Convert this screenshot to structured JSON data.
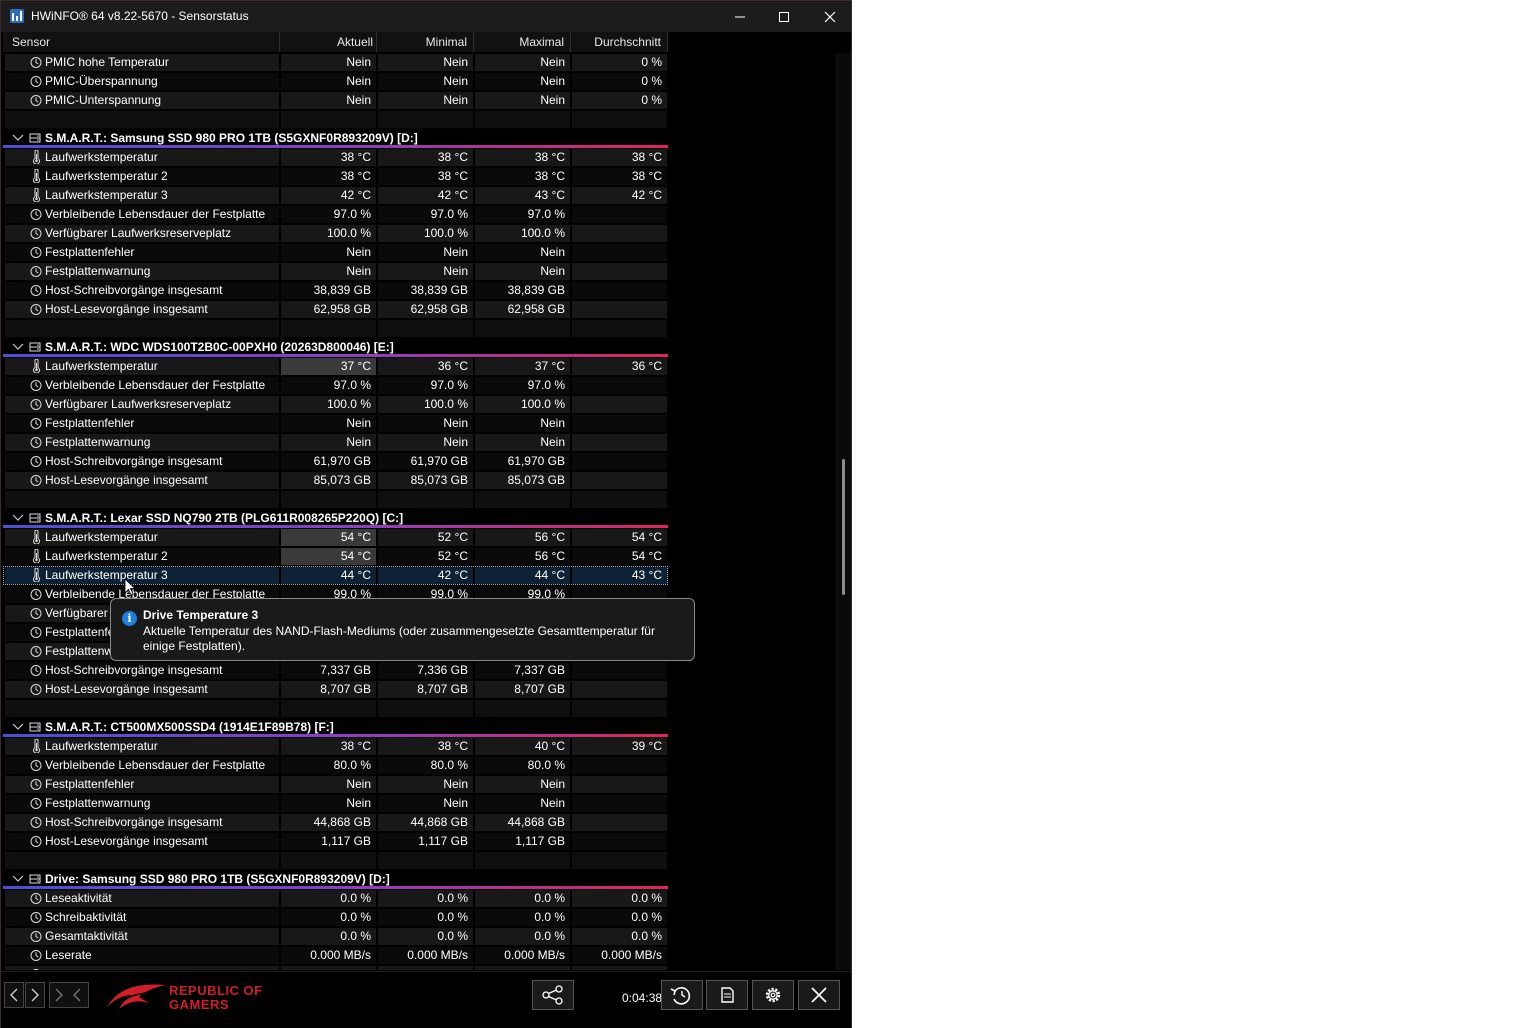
{
  "window": {
    "title": "HWiNFO® 64 v8.22-5670 - Sensorstatus",
    "controls": {
      "minimize": "—",
      "maximize": "☐",
      "close": "✕"
    }
  },
  "columns": [
    "Sensor",
    "Aktuell",
    "Minimal",
    "Maximal",
    "Durchschnitt"
  ],
  "rows": [
    {
      "type": "row",
      "icon": "clock",
      "cells": [
        "PMIC hohe Temperatur",
        "Nein",
        "Nein",
        "Nein",
        "0 %"
      ]
    },
    {
      "type": "row",
      "icon": "clock",
      "cells": [
        "PMIC-Überspannung",
        "Nein",
        "Nein",
        "Nein",
        "0 %"
      ]
    },
    {
      "type": "row",
      "icon": "clock",
      "cells": [
        "PMIC-Unterspannung",
        "Nein",
        "Nein",
        "Nein",
        "0 %"
      ]
    },
    {
      "type": "blank"
    },
    {
      "type": "group",
      "label": "S.M.A.R.T.: Samsung SSD 980 PRO 1TB (S5GXNF0R893209V) [D:]"
    },
    {
      "type": "row",
      "icon": "thermo",
      "cells": [
        "Laufwerkstemperatur",
        "38 °C",
        "38 °C",
        "38 °C",
        "38 °C"
      ]
    },
    {
      "type": "row",
      "icon": "thermo",
      "cells": [
        "Laufwerkstemperatur 2",
        "38 °C",
        "38 °C",
        "38 °C",
        "38 °C"
      ]
    },
    {
      "type": "row",
      "icon": "thermo",
      "cells": [
        "Laufwerkstemperatur 3",
        "42 °C",
        "42 °C",
        "43 °C",
        "42 °C"
      ]
    },
    {
      "type": "row",
      "icon": "clock",
      "cells": [
        "Verbleibende Lebensdauer der Festplatte",
        "97.0 %",
        "97.0 %",
        "97.0 %",
        ""
      ]
    },
    {
      "type": "row",
      "icon": "clock",
      "cells": [
        "Verfügbarer Laufwerksreserveplatz",
        "100.0 %",
        "100.0 %",
        "100.0 %",
        ""
      ]
    },
    {
      "type": "row",
      "icon": "clock",
      "cells": [
        "Festplattenfehler",
        "Nein",
        "Nein",
        "Nein",
        ""
      ]
    },
    {
      "type": "row",
      "icon": "clock",
      "cells": [
        "Festplattenwarnung",
        "Nein",
        "Nein",
        "Nein",
        ""
      ]
    },
    {
      "type": "row",
      "icon": "clock",
      "cells": [
        "Host-Schreibvorgänge insgesamt",
        "38,839 GB",
        "38,839 GB",
        "38,839 GB",
        ""
      ]
    },
    {
      "type": "row",
      "icon": "clock",
      "cells": [
        "Host-Lesevorgänge insgesamt",
        "62,958 GB",
        "62,958 GB",
        "62,958 GB",
        ""
      ]
    },
    {
      "type": "blank"
    },
    {
      "type": "group",
      "label": "S.M.A.R.T.: WDC WDS100T2B0C-00PXH0 (20263D800046) [E:]"
    },
    {
      "type": "row",
      "icon": "thermo",
      "hl": true,
      "cells": [
        "Laufwerkstemperatur",
        "37 °C",
        "36 °C",
        "37 °C",
        "36 °C"
      ]
    },
    {
      "type": "row",
      "icon": "clock",
      "cells": [
        "Verbleibende Lebensdauer der Festplatte",
        "97.0 %",
        "97.0 %",
        "97.0 %",
        ""
      ]
    },
    {
      "type": "row",
      "icon": "clock",
      "cells": [
        "Verfügbarer Laufwerksreserveplatz",
        "100.0 %",
        "100.0 %",
        "100.0 %",
        ""
      ]
    },
    {
      "type": "row",
      "icon": "clock",
      "cells": [
        "Festplattenfehler",
        "Nein",
        "Nein",
        "Nein",
        ""
      ]
    },
    {
      "type": "row",
      "icon": "clock",
      "cells": [
        "Festplattenwarnung",
        "Nein",
        "Nein",
        "Nein",
        ""
      ]
    },
    {
      "type": "row",
      "icon": "clock",
      "cells": [
        "Host-Schreibvorgänge insgesamt",
        "61,970 GB",
        "61,970 GB",
        "61,970 GB",
        ""
      ]
    },
    {
      "type": "row",
      "icon": "clock",
      "cells": [
        "Host-Lesevorgänge insgesamt",
        "85,073 GB",
        "85,073 GB",
        "85,073 GB",
        ""
      ]
    },
    {
      "type": "blank"
    },
    {
      "type": "group",
      "label": "S.M.A.R.T.: Lexar SSD NQ790 2TB (PLG611R008265P220Q) [C:]"
    },
    {
      "type": "row",
      "icon": "thermo",
      "hl": true,
      "cells": [
        "Laufwerkstemperatur",
        "54 °C",
        "52 °C",
        "56 °C",
        "54 °C"
      ]
    },
    {
      "type": "row",
      "icon": "thermo",
      "hl": true,
      "cells": [
        "Laufwerkstemperatur 2",
        "54 °C",
        "52 °C",
        "56 °C",
        "54 °C"
      ]
    },
    {
      "type": "row",
      "icon": "thermo",
      "sel": true,
      "cells": [
        "Laufwerkstemperatur 3",
        "44 °C",
        "42 °C",
        "44 °C",
        "43 °C"
      ]
    },
    {
      "type": "row",
      "icon": "clock",
      "cells": [
        "Verbleibende Lebensdauer der Festplatte",
        "99.0 %",
        "99.0 %",
        "99.0 %",
        ""
      ]
    },
    {
      "type": "row",
      "icon": "clock",
      "cells": [
        "Verfügbarer Laufwerksreserveplatz",
        "",
        "",
        "",
        ""
      ]
    },
    {
      "type": "row",
      "icon": "clock",
      "cells": [
        "Festplattenfehler",
        "",
        "",
        "",
        ""
      ]
    },
    {
      "type": "row",
      "icon": "clock",
      "cells": [
        "Festplattenwarnung",
        "",
        "",
        "",
        ""
      ]
    },
    {
      "type": "row",
      "icon": "clock",
      "cells": [
        "Host-Schreibvorgänge insgesamt",
        "7,337 GB",
        "7,336 GB",
        "7,337 GB",
        ""
      ]
    },
    {
      "type": "row",
      "icon": "clock",
      "cells": [
        "Host-Lesevorgänge insgesamt",
        "8,707 GB",
        "8,707 GB",
        "8,707 GB",
        ""
      ]
    },
    {
      "type": "blank"
    },
    {
      "type": "group",
      "label": "S.M.A.R.T.: CT500MX500SSD4 (1914E1F89B78) [F:]"
    },
    {
      "type": "row",
      "icon": "thermo",
      "cells": [
        "Laufwerkstemperatur",
        "38 °C",
        "38 °C",
        "40 °C",
        "39 °C"
      ]
    },
    {
      "type": "row",
      "icon": "clock",
      "cells": [
        "Verbleibende Lebensdauer der Festplatte",
        "80.0 %",
        "80.0 %",
        "80.0 %",
        ""
      ]
    },
    {
      "type": "row",
      "icon": "clock",
      "cells": [
        "Festplattenfehler",
        "Nein",
        "Nein",
        "Nein",
        ""
      ]
    },
    {
      "type": "row",
      "icon": "clock",
      "cells": [
        "Festplattenwarnung",
        "Nein",
        "Nein",
        "Nein",
        ""
      ]
    },
    {
      "type": "row",
      "icon": "clock",
      "cells": [
        "Host-Schreibvorgänge insgesamt",
        "44,868 GB",
        "44,868 GB",
        "44,868 GB",
        ""
      ]
    },
    {
      "type": "row",
      "icon": "clock",
      "cells": [
        "Host-Lesevorgänge insgesamt",
        "1,117 GB",
        "1,117 GB",
        "1,117 GB",
        ""
      ]
    },
    {
      "type": "blank"
    },
    {
      "type": "group",
      "label": "Drive: Samsung SSD 980 PRO 1TB (S5GXNF0R893209V) [D:]"
    },
    {
      "type": "row",
      "icon": "clock",
      "cells": [
        "Leseaktivität",
        "0.0 %",
        "0.0 %",
        "0.0 %",
        "0.0 %"
      ]
    },
    {
      "type": "row",
      "icon": "clock",
      "cells": [
        "Schreibaktivität",
        "0.0 %",
        "0.0 %",
        "0.0 %",
        "0.0 %"
      ]
    },
    {
      "type": "row",
      "icon": "clock",
      "cells": [
        "Gesamtaktivität",
        "0.0 %",
        "0.0 %",
        "0.0 %",
        "0.0 %"
      ]
    },
    {
      "type": "row",
      "icon": "clock",
      "cells": [
        "Leserate",
        "0.000 MB/s",
        "0.000 MB/s",
        "0.000 MB/s",
        "0.000 MB/s"
      ]
    },
    {
      "type": "row",
      "icon": "clock",
      "cells": [
        "",
        "",
        "",
        "",
        ""
      ]
    }
  ],
  "tooltip": {
    "title": "Drive Temperature 3",
    "text": "Aktuelle Temperatur des NAND-Flash-Mediums (oder zusammengesetzte Gesamttemperatur für einige Festplatten).",
    "icon": "info-icon"
  },
  "bottom": {
    "timer": "0:04:38",
    "brand_line1": "REPUBLIC OF",
    "brand_line2": "GAMERS",
    "buttons": [
      "network-icon",
      "reset-icon",
      "report-icon",
      "settings-icon",
      "close-icon"
    ]
  },
  "colors": {
    "background": "#000000",
    "row_even": "#181818",
    "row_odd": "#0a0a0a",
    "group_line_start": "#4b4fd6",
    "group_line_end": "#e0245e",
    "rog_red": "#d01e2a",
    "info_blue": "#1e7fd8"
  }
}
